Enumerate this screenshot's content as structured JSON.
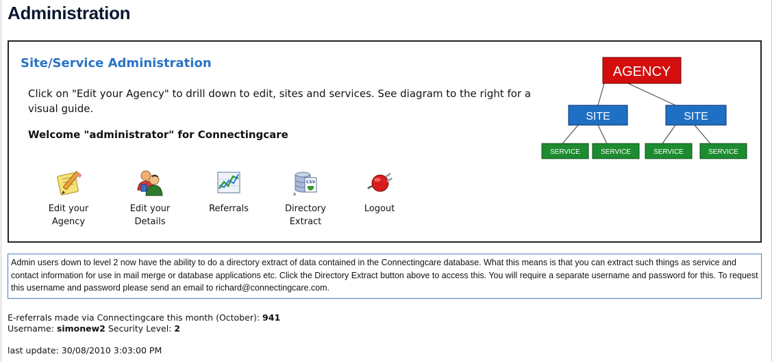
{
  "page_title": "Administration",
  "admin": {
    "section_title": "Site/Service Administration",
    "intro": "Click on \"Edit your Agency\" to drill down to edit, sites and services. See diagram to the right for a visual guide.",
    "welcome": "Welcome \"administrator\" for Connectingcare",
    "actions": [
      {
        "label": "Edit your\nAgency",
        "icon": "notepad-pencil-icon"
      },
      {
        "label": "Edit your\nDetails",
        "icon": "users-icon"
      },
      {
        "label": "Referrals",
        "icon": "line-chart-icon"
      },
      {
        "label": "Directory\nExtract",
        "icon": "database-csv-icon"
      },
      {
        "label": "Logout",
        "icon": "power-plug-icon"
      }
    ]
  },
  "diagram": {
    "agency": "AGENCY",
    "site": "SITE",
    "service": "SERVICE",
    "colors": {
      "agency": "#d40e0e",
      "site": "#1f6fc5",
      "service": "#1d8c30"
    }
  },
  "info": "Admin users down to level 2 now have the ability to do a directory extract of data contained in the Connectingcare database. What this means is that you can extract such things as service and contact information for use in mail merge or database applications etc. Click the Directory Extract button above to access this. You will require a separate username and password for this. To request this username and password please send an email to richard@connectingcare.com.",
  "stats": {
    "referrals_label": "E-referrals made via Connectingcare this month (October):",
    "referrals_count": "941",
    "username_label": "Username:",
    "username": "simonew2",
    "security_label": "Security Level:",
    "security_level": "2"
  },
  "last_update": "last update: 30/08/2010 3:03:00 PM"
}
